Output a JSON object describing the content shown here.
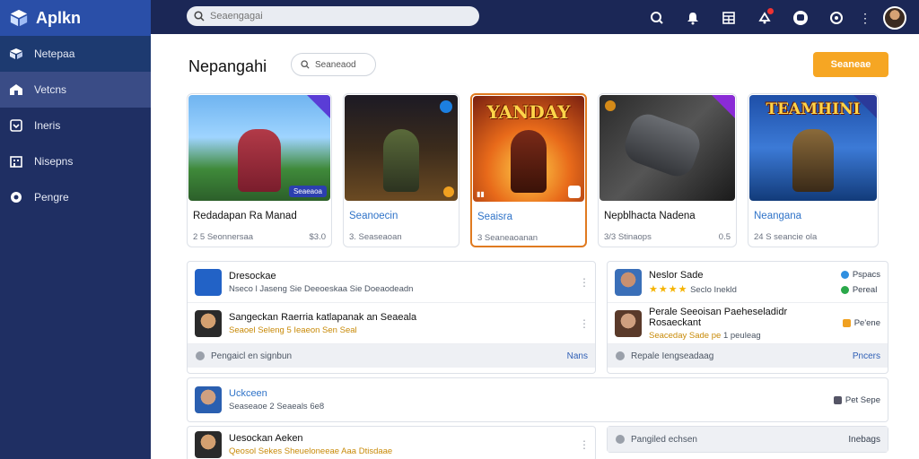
{
  "app": {
    "name": "Aplkn"
  },
  "sidebar": {
    "items": [
      {
        "label": "Netepaa",
        "icon": "box-icon"
      },
      {
        "label": "Vetcns",
        "icon": "home-icon"
      },
      {
        "label": "Ineris",
        "icon": "inbox-icon"
      },
      {
        "label": "Nisepns",
        "icon": "building-icon"
      },
      {
        "label": "Pengre",
        "icon": "circle-icon"
      }
    ]
  },
  "topbar": {
    "search_placeholder": "Seaengagai"
  },
  "main": {
    "title": "Nepangahi",
    "filter_label": "Seaneaod",
    "cta_label": "Seaneae"
  },
  "cards": [
    {
      "title": "Redadapan Ra Manad",
      "meta_left": "2 5 Seonnersaa",
      "meta_right": "$3.0",
      "tag": "Seaeaoa",
      "title_color": "dark"
    },
    {
      "title": "Seanoecin",
      "meta_left": "3. Seaseaoan",
      "meta_right": "",
      "tag": "",
      "title_color": "blue"
    },
    {
      "title": "Seaisra",
      "meta_left": "3 Seaneaoanan",
      "meta_right": "",
      "tag": "",
      "banner": "YANDAY",
      "title_color": "blue"
    },
    {
      "title": "Nepblhacta Nadena",
      "meta_left": "3/3 Stinaops",
      "meta_right": "0.5",
      "tag": "",
      "title_color": "dark"
    },
    {
      "title": "Neangana",
      "meta_left": "24 S seancie ola",
      "meta_right": "",
      "tag": "",
      "banner": "TEAMHINI",
      "title_color": "blue"
    }
  ],
  "feed_left": [
    {
      "title": "Dresockae",
      "sub": "Nseco l Jaseng Sie Deeoeskaa Sie Doeaodeadn",
      "gold": ""
    },
    {
      "title": "Sangeckan Raerria katlapanak an Seaeala",
      "sub": "Seaoel Seleng 5 Ieaeon Sen Seal",
      "gold": "Seaoel Seleng"
    }
  ],
  "feed_left_footer": {
    "left": "Pengaicl en signbun",
    "right": "Nans"
  },
  "feed_right": [
    {
      "title": "Neslor Sade",
      "sub": "Seclo Inekld",
      "side1": "Pspacs",
      "side2": "Pereal"
    },
    {
      "title": "Perale Seeoisan Paeheseladidr Rosaeckant",
      "sub": "1 peuleag",
      "gold": "Seaceday Sade pe",
      "side1": "Pe'ene"
    }
  ],
  "feed_right_footer": {
    "left": "Repale Iengseadaag",
    "right": "Pncers"
  },
  "wide_row": {
    "title": "Uckceen",
    "sub": "Seaseaoe 2 Seaeals 6e8",
    "side": "Pet Sepe"
  },
  "last_row": {
    "title": "Uesockan Aeken",
    "sub": "Qeosol Sekes Sheueloneeae Aaa Dtisdaae"
  },
  "last_footer": {
    "left": "Pangiled echsen",
    "right": "Inebags"
  }
}
